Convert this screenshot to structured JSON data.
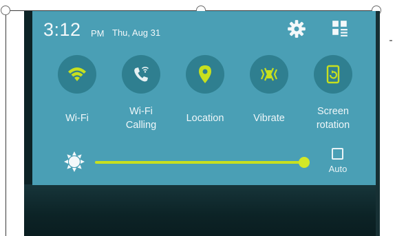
{
  "status": {
    "time": "3:12",
    "ampm": "PM",
    "date": "Thu, Aug 31"
  },
  "header_icons": {
    "settings": "gear-icon",
    "edit": "grid-edit-icon"
  },
  "tiles": [
    {
      "label": "Wi-Fi",
      "icon": "wifi-icon",
      "active": true
    },
    {
      "label": "Wi-Fi Calling",
      "icon": "wifi-calling-icon",
      "active": false
    },
    {
      "label": "Location",
      "icon": "location-pin-icon",
      "active": true
    },
    {
      "label": "Vibrate",
      "icon": "vibrate-icon",
      "active": true
    },
    {
      "label": "Screen rotation",
      "icon": "screen-rotation-icon",
      "active": true
    }
  ],
  "brightness": {
    "icon": "sun-icon",
    "level": 0.95,
    "auto_label": "Auto",
    "auto_checked": false
  },
  "colors": {
    "panel": "#4a9fb5",
    "tile_circle": "#2f7f90",
    "accent": "#c7e01f",
    "inactive_icon": "#e6f0f2"
  }
}
